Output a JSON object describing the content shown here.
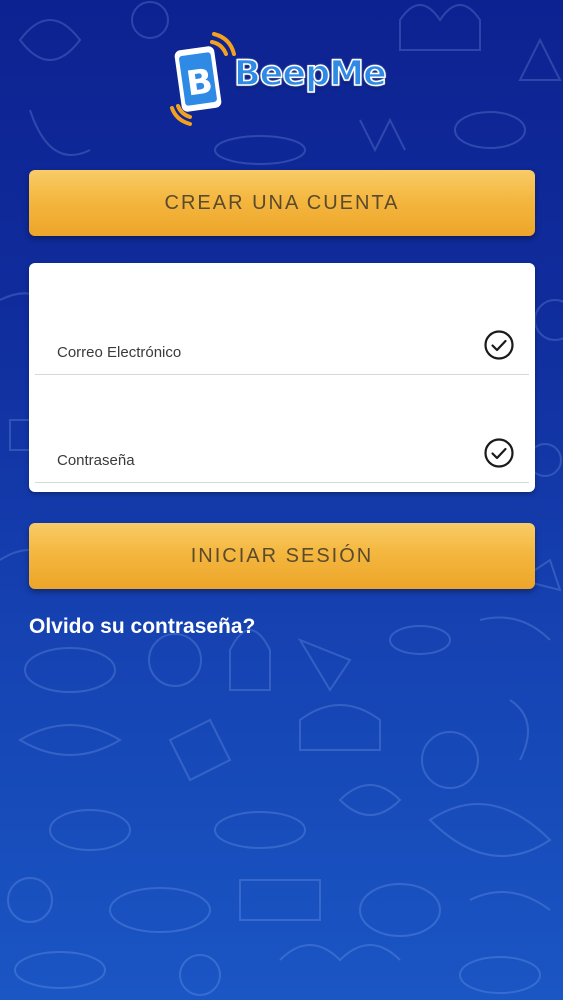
{
  "app": {
    "name": "BeepMe",
    "logo_letter": "B",
    "brand_color": "#2f8ae6",
    "accent_color": "#f4b73f"
  },
  "buttons": {
    "create_account": "CREAR UNA CUENTA",
    "login": "INICIAR SESIÓN"
  },
  "form": {
    "email_label": "Correo Electrónico",
    "password_label": "Contraseña",
    "email_icon": "check-circle-icon",
    "password_icon": "check-circle-icon"
  },
  "links": {
    "forgot_password": "Olvido su contraseña?"
  },
  "background": {
    "pattern": "food-doodles",
    "gradient_top": "#0d2291",
    "gradient_bottom": "#1a56c4"
  }
}
